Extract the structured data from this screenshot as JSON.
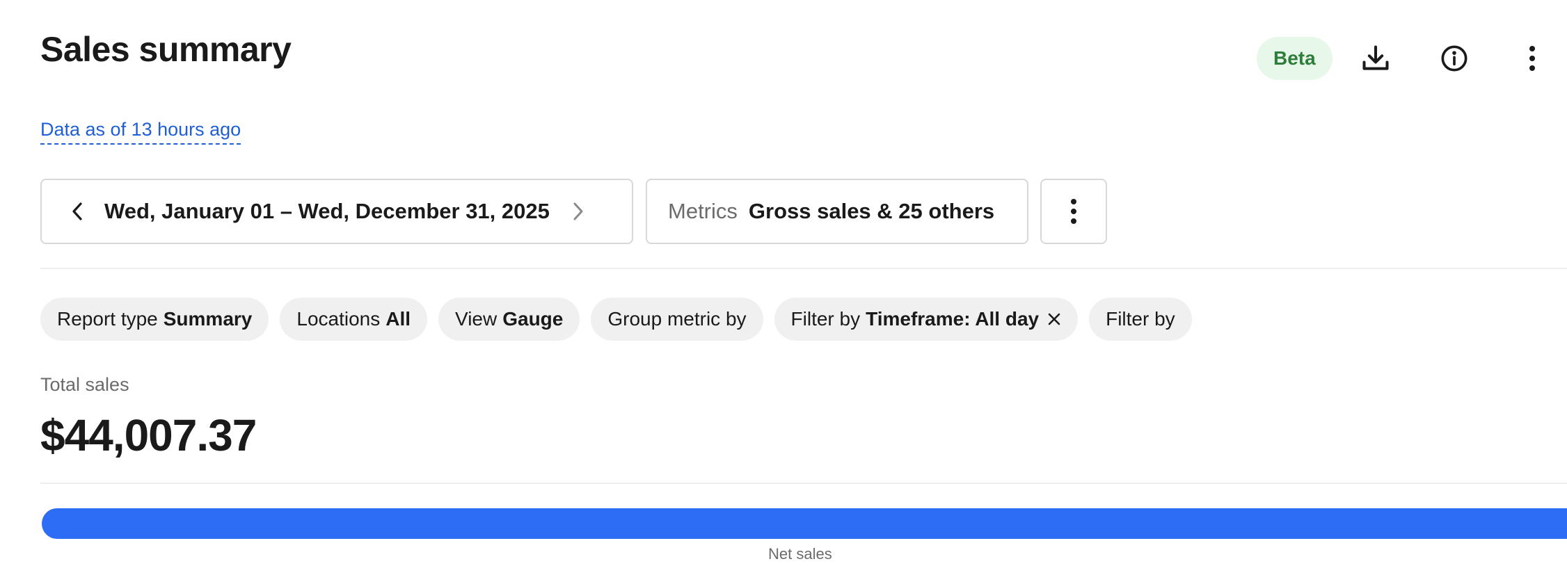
{
  "header": {
    "title": "Sales summary",
    "badge": "Beta",
    "actions": [
      {
        "icon": "download-icon"
      },
      {
        "icon": "info-icon"
      },
      {
        "icon": "more-vertical-icon"
      }
    ]
  },
  "data_freshness": "Data as of 13 hours ago",
  "controls": {
    "date_range": "Wed, January 01 – Wed, December 31, 2025",
    "metrics_label": "Metrics",
    "metrics_value": "Gross sales & 25 others"
  },
  "chips": [
    {
      "label": "Report type",
      "value": "Summary"
    },
    {
      "label": "Locations",
      "value": "All"
    },
    {
      "label": "View",
      "value": "Gauge"
    },
    {
      "label": "Group metric by",
      "value": ""
    },
    {
      "label": "Filter by",
      "value": "Timeframe: All day",
      "removable": true
    },
    {
      "label": "Filter by",
      "value": ""
    }
  ],
  "summary": {
    "label": "Total sales",
    "value": "$44,007.37"
  },
  "gauge": {
    "segment_label": "Net sales",
    "fill_fraction": 1.0,
    "color": "#2d6cf5"
  },
  "colors": {
    "accent": "#2d6cf5",
    "link": "#1f5fd6",
    "badge_bg": "#e7f8ea",
    "badge_text": "#2f7d3b"
  }
}
